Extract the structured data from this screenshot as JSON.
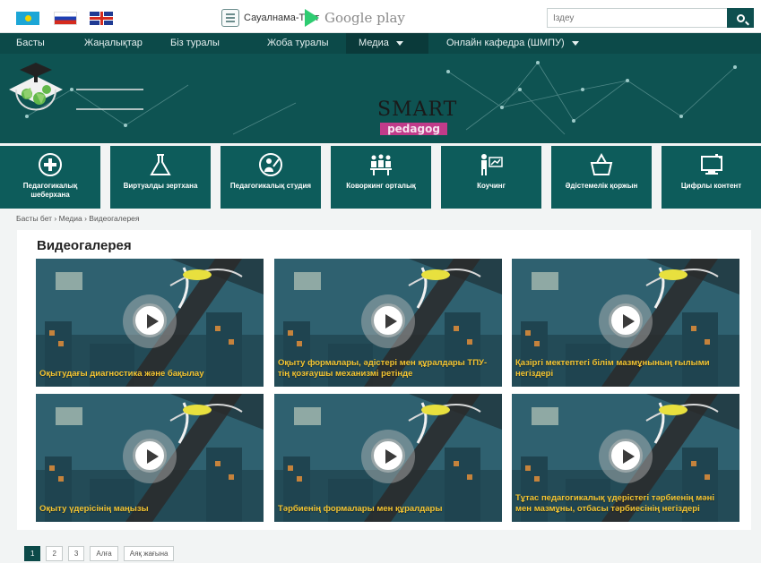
{
  "topbar": {
    "flags": [
      "kz-flag",
      "ru-flag",
      "uk-flag"
    ],
    "quiz_label": "Сауалнама-Тест",
    "google_play_label": "Google play",
    "search_placeholder": "Іздеу"
  },
  "nav": {
    "items": [
      {
        "label": "Басты"
      },
      {
        "label": "Жаңалықтар"
      },
      {
        "label": "Біз туралы"
      },
      {
        "label": "Жоба туралы"
      },
      {
        "label": "Медиа"
      },
      {
        "label": "Онлайн кафедра (ШМПУ)"
      }
    ]
  },
  "banner": {
    "logo_main": "SMART",
    "logo_sub": "pedagog"
  },
  "tiles": [
    {
      "label": "Педагогикалық шеберхана",
      "icon": "plus-badge-icon"
    },
    {
      "label": "Виртуалды зертхана",
      "icon": "flask-icon"
    },
    {
      "label": "Педагогикалық студия",
      "icon": "teacher-icon"
    },
    {
      "label": "Коворкинг орталық",
      "icon": "coworking-icon"
    },
    {
      "label": "Коучинг",
      "icon": "coaching-icon"
    },
    {
      "label": "Әдістемелік қоржын",
      "icon": "basket-icon"
    },
    {
      "label": "Цифрлы контент",
      "icon": "monitor-icon"
    }
  ],
  "breadcrumb": "Басты бет › Медиа › Видеогалерея",
  "gallery": {
    "title": "Видеогалерея",
    "videos": [
      {
        "caption": "Оқытудағы диагностика және бақылау"
      },
      {
        "caption": "Оқыту формалары, әдістері мен құралдары ТПУ-тің қозғаушы механизмі ретінде"
      },
      {
        "caption": "Қазіргі мектептегі білім мазмұнының ғылыми негіздері"
      },
      {
        "caption": "Оқыту үдерісінің маңызы"
      },
      {
        "caption": "Тәрбиенің формалары мен құралдары"
      },
      {
        "caption": "Тұтас педагогикалық үдерістегі тәрбиенің мәні мен мазмұны, отбасы тәрбиесінің негіздері"
      }
    ]
  },
  "pager": {
    "pages": [
      "1",
      "2",
      "3"
    ],
    "next_label": "Алға",
    "last_label": "Аяқ жағына",
    "active": "1"
  }
}
